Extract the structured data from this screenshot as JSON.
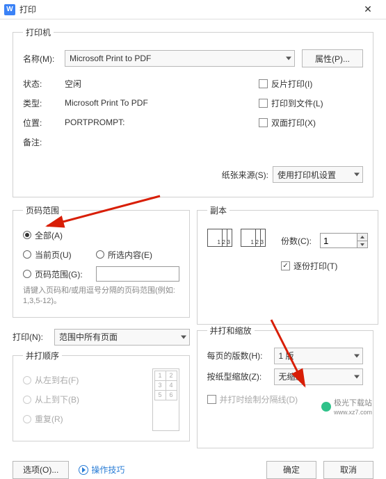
{
  "title": "打印",
  "printer": {
    "legend": "打印机",
    "name_label": "名称(M):",
    "name_value": "Microsoft Print to PDF",
    "properties_btn": "属性(P)...",
    "status_label": "状态:",
    "status_value": "空闲",
    "type_label": "类型:",
    "type_value": "Microsoft Print To PDF",
    "where_label": "位置:",
    "where_value": "PORTPROMPT:",
    "comment_label": "备注:",
    "comment_value": "",
    "flip_label": "反片打印(I)",
    "to_file_label": "打印到文件(L)",
    "duplex_label": "双面打印(X)",
    "source_label": "纸张来源(S):",
    "source_value": "使用打印机设置"
  },
  "range": {
    "legend": "页码范围",
    "all": "全部(A)",
    "current": "当前页(U)",
    "selection": "所选内容(E)",
    "pages": "页码范围(G):",
    "pages_value": "",
    "hint": "请键入页码和/或用逗号分隔的页码范围(例如: 1,3,5-12)。"
  },
  "copies": {
    "legend": "副本",
    "count_label": "份数(C):",
    "count_value": "1",
    "collate_label": "逐份打印(T)",
    "collate_checked": true
  },
  "print_what": {
    "label": "打印(N):",
    "value": "范围中所有页面"
  },
  "order": {
    "legend": "并打顺序",
    "lr": "从左到右(F)",
    "tb": "从上到下(B)",
    "repeat": "重复(R)"
  },
  "zoom": {
    "legend": "并打和缩放",
    "per_sheet_label": "每页的版数(H):",
    "per_sheet_value": "1 版",
    "scale_label": "按纸型缩放(Z):",
    "scale_value": "无缩放",
    "draw_line_label": "并打时绘制分隔线(D)"
  },
  "footer": {
    "options": "选项(O)...",
    "tips": "操作技巧",
    "ok": "确定",
    "cancel": "取消"
  },
  "watermark": {
    "brand": "极光下载站",
    "url": "www.xz7.com"
  }
}
